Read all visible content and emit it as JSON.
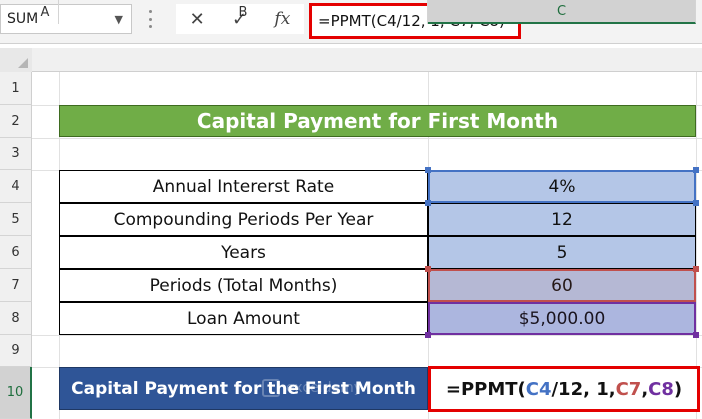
{
  "formula_bar": {
    "name_box": "SUM",
    "cancel_icon": "✕",
    "enter_icon": "✓",
    "fx_label": "fx",
    "formula": "=PPMT(C4/12, 1, C7, C8)"
  },
  "columns": [
    "A",
    "B",
    "C"
  ],
  "rows": [
    "1",
    "2",
    "3",
    "4",
    "5",
    "6",
    "7",
    "8",
    "9",
    "10"
  ],
  "title": "Capital Payment for First Month",
  "table": [
    {
      "label": "Annual Intererst Rate",
      "value": "4%"
    },
    {
      "label": "Compounding Periods Per Year",
      "value": "12"
    },
    {
      "label": "Years",
      "value": "5"
    },
    {
      "label": "Periods (Total Months)",
      "value": "60"
    },
    {
      "label": "Loan Amount",
      "value": "$5,000.00"
    }
  ],
  "result": {
    "label": "Capital Payment for the First Month",
    "formula_parts": [
      "=PPMT(",
      "C4",
      "/12, 1, ",
      "C7",
      ", ",
      "C8",
      ")"
    ]
  },
  "watermark": "exceldemy",
  "colors": {
    "title_bg": "#70ad47",
    "value_bg": "#b4c6e7",
    "result_label_bg": "#2f5597",
    "highlight_red": "#e40000",
    "ref_c4": "#4472c4",
    "ref_c7": "#c0504d",
    "ref_c8": "#7030a0"
  }
}
